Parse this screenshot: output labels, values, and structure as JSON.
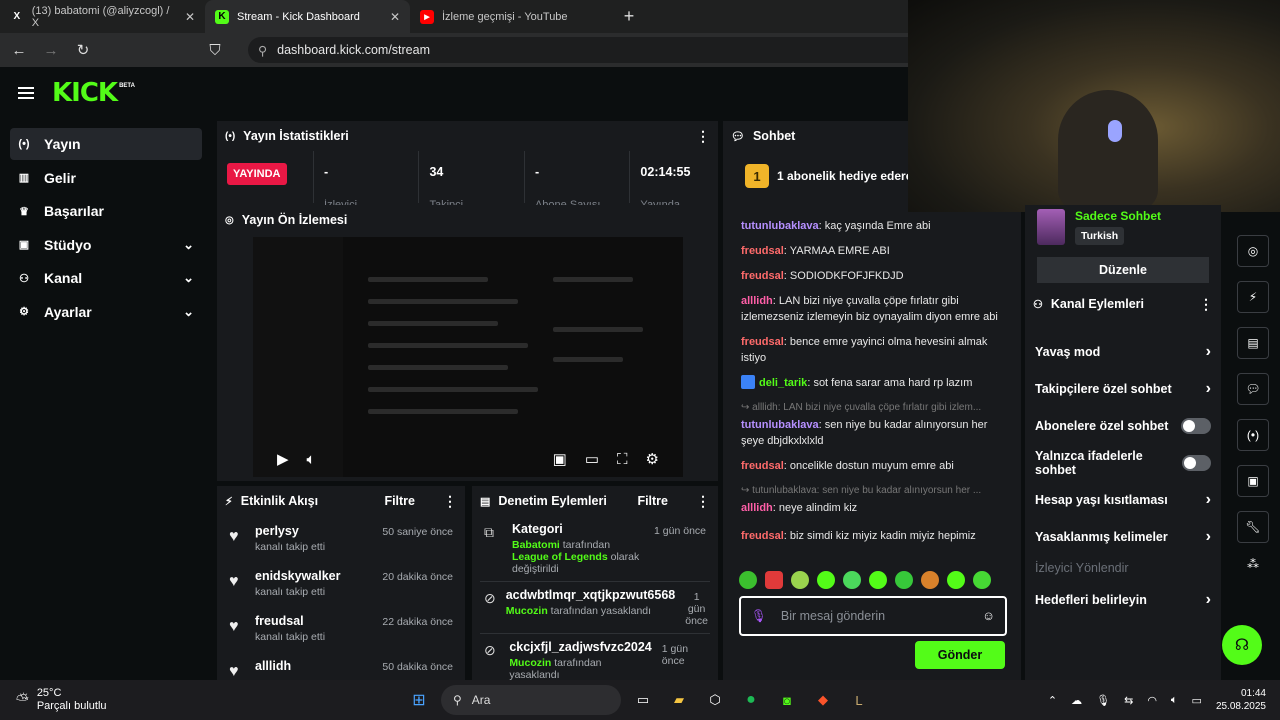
{
  "browser": {
    "tabs": [
      {
        "title": "(13) babatomi (@aliyzcogl) / X",
        "favicon": "X"
      },
      {
        "title": "Stream - Kick Dashboard",
        "favicon": "K"
      },
      {
        "title": "İzleme geçmişi - YouTube",
        "favicon": "▶"
      }
    ],
    "url": "dashboard.kick.com/stream"
  },
  "brand": {
    "logo": "KICK",
    "badge": "BETA",
    "accent": "#53fc18"
  },
  "sidebar": {
    "items": [
      {
        "label": "Yayın",
        "icon": "broadcast-icon"
      },
      {
        "label": "Gelir",
        "icon": "chart-icon"
      },
      {
        "label": "Başarılar",
        "icon": "trophy-icon"
      },
      {
        "label": "Stüdyo",
        "icon": "studio-icon"
      },
      {
        "label": "Kanal",
        "icon": "users-icon"
      },
      {
        "label": "Ayarlar",
        "icon": "gear-icon"
      }
    ]
  },
  "stats_panel": {
    "title": "Yayın İstatistikleri",
    "live_badge": "YAYINDA",
    "stats": [
      {
        "value": "-",
        "label": "İzleyici"
      },
      {
        "value": "34",
        "label": "Takipçi"
      },
      {
        "value": "-",
        "label": "Abone Sayısı"
      },
      {
        "value": "02:14:55",
        "label": "Yayında"
      }
    ]
  },
  "preview_panel": {
    "title": "Yayın Ön İzlemesi"
  },
  "activity_panel": {
    "title": "Etkinlik Akışı",
    "filter": "Filtre",
    "items": [
      {
        "user": "perlysy",
        "action": "kanalı takip etti",
        "time": "50 saniye önce"
      },
      {
        "user": "enidskywalker",
        "action": "kanalı takip etti",
        "time": "20 dakika önce"
      },
      {
        "user": "freudsal",
        "action": "kanalı takip etti",
        "time": "22 dakika önce"
      },
      {
        "user": "alllidh",
        "action": "",
        "time": "50 dakika önce"
      }
    ]
  },
  "moderation_panel": {
    "title": "Denetim Eylemleri",
    "filter": "Filtre",
    "items": [
      {
        "title": "Kategori",
        "time": "1 gün önce",
        "actor": "Babatomi",
        "middle": "tarafından",
        "target": "League of Legends",
        "rest": "olarak değiştirildi"
      },
      {
        "title": "acdwbtlmqr_xqtjkpzwut6568",
        "time": "1 gün önce",
        "actor": "Mucozin",
        "middle": "tarafından yasaklandı",
        "target": "",
        "rest": ""
      },
      {
        "title": "ckcjxfjl_zadjwsfvzc2024",
        "time": "1 gün önce",
        "actor": "Mucozin",
        "middle": "tarafından yasaklandı",
        "target": "",
        "rest": ""
      }
    ]
  },
  "chat": {
    "title": "Sohbet",
    "pinned": "1 abonelik hediye ederek",
    "messages": [
      {
        "user": "tutunlubaklava",
        "color": "#b690ff",
        "text": "kaç yaşında Emre abi"
      },
      {
        "user": "freudsal",
        "color": "#ff6b6b",
        "text": "YARMAA EMRE ABI"
      },
      {
        "user": "freudsal",
        "color": "#ff6b6b",
        "text": "SODIODKFOFJFKDJD"
      },
      {
        "user": "alllidh",
        "color": "#ff5fa8",
        "text": "LAN bizi niye çuvalla çöpe fırlatır gibi izlemezseniz izlemeyin biz oynayalim diyon emre abi"
      },
      {
        "user": "freudsal",
        "color": "#ff6b6b",
        "text": "bence emre yayinci olma hevesini almak istiyo"
      },
      {
        "user": "deli_tarik",
        "color": "#53fc18",
        "text": "sot fena sarar ama hard rp lazım"
      },
      {
        "reply": "alllidh: LAN bizi niye çuvalla çöpe fırlatır gibi izlem..."
      },
      {
        "user": "tutunlubaklava",
        "color": "#b690ff",
        "text": "sen niye bu kadar alınıyorsun her şeye dbjdkxlxlxld"
      },
      {
        "user": "freudsal",
        "color": "#ff6b6b",
        "text": "oncelikle dostun muyum emre abi"
      },
      {
        "reply": "tutunlubaklava: sen niye bu kadar alınıyorsun her ..."
      },
      {
        "user": "alllidh",
        "color": "#ff5fa8",
        "text": "neye alindim kiz"
      },
      {
        "user": "freudsal",
        "color": "#ff6b6b",
        "text": "biz simdi kiz miyiz kadin miyiz hepimiz"
      }
    ],
    "placeholder": "Bir mesaj gönderin",
    "send": "Gönder"
  },
  "channel_actions": {
    "mode_label": "Sadece Sohbet",
    "language": "Turkish",
    "edit": "Düzenle",
    "title": "Kanal Eylemleri",
    "rows": [
      {
        "label": "Yavaş mod",
        "control": "chevron"
      },
      {
        "label": "Takipçilere özel sohbet",
        "control": "chevron"
      },
      {
        "label": "Abonelere özel sohbet",
        "control": "toggle"
      },
      {
        "label": "Yalnızca ifadelerle sohbet",
        "control": "toggle"
      },
      {
        "label": "Hesap yaşı kısıtlaması",
        "control": "chevron"
      },
      {
        "label": "Yasaklanmış kelimeler",
        "control": "chevron"
      }
    ],
    "section": "İzleyici Yönlendir",
    "goals": "Hedefleri belirleyin"
  },
  "taskbar": {
    "temp": "25°C",
    "weather": "Parçalı bulutlu",
    "search": "Ara",
    "time": "01:44",
    "date": "25.08.2025"
  }
}
